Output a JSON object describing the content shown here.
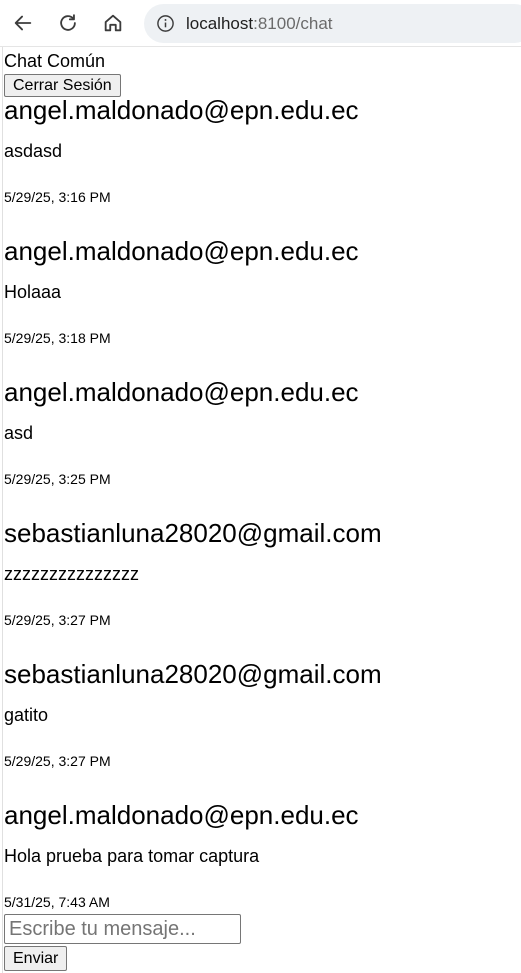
{
  "browser": {
    "url_host": "localhost",
    "url_path": ":8100/chat",
    "icons": [
      "back-arrow-icon",
      "reload-icon",
      "home-icon",
      "site-info-icon"
    ]
  },
  "page": {
    "title": "Chat Común",
    "logout_label": "Cerrar Sesión"
  },
  "messages": [
    {
      "sender": "angel.maldonado@epn.edu.ec",
      "text": "asdasd",
      "time": "5/29/25, 3:16 PM"
    },
    {
      "sender": "angel.maldonado@epn.edu.ec",
      "text": "Holaaa",
      "time": "5/29/25, 3:18 PM"
    },
    {
      "sender": "angel.maldonado@epn.edu.ec",
      "text": "asd",
      "time": "5/29/25, 3:25 PM"
    },
    {
      "sender": "sebastianluna28020@gmail.com",
      "text": "zzzzzzzzzzzzzzz",
      "time": "5/29/25, 3:27 PM"
    },
    {
      "sender": "sebastianluna28020@gmail.com",
      "text": "gatito",
      "time": "5/29/25, 3:27 PM"
    },
    {
      "sender": "angel.maldonado@epn.edu.ec",
      "text": "Hola prueba para tomar captura",
      "time": "5/31/25, 7:43 AM"
    }
  ],
  "composer": {
    "placeholder": "Escribe tu mensaje...",
    "value": "",
    "send_label": "Enviar"
  }
}
